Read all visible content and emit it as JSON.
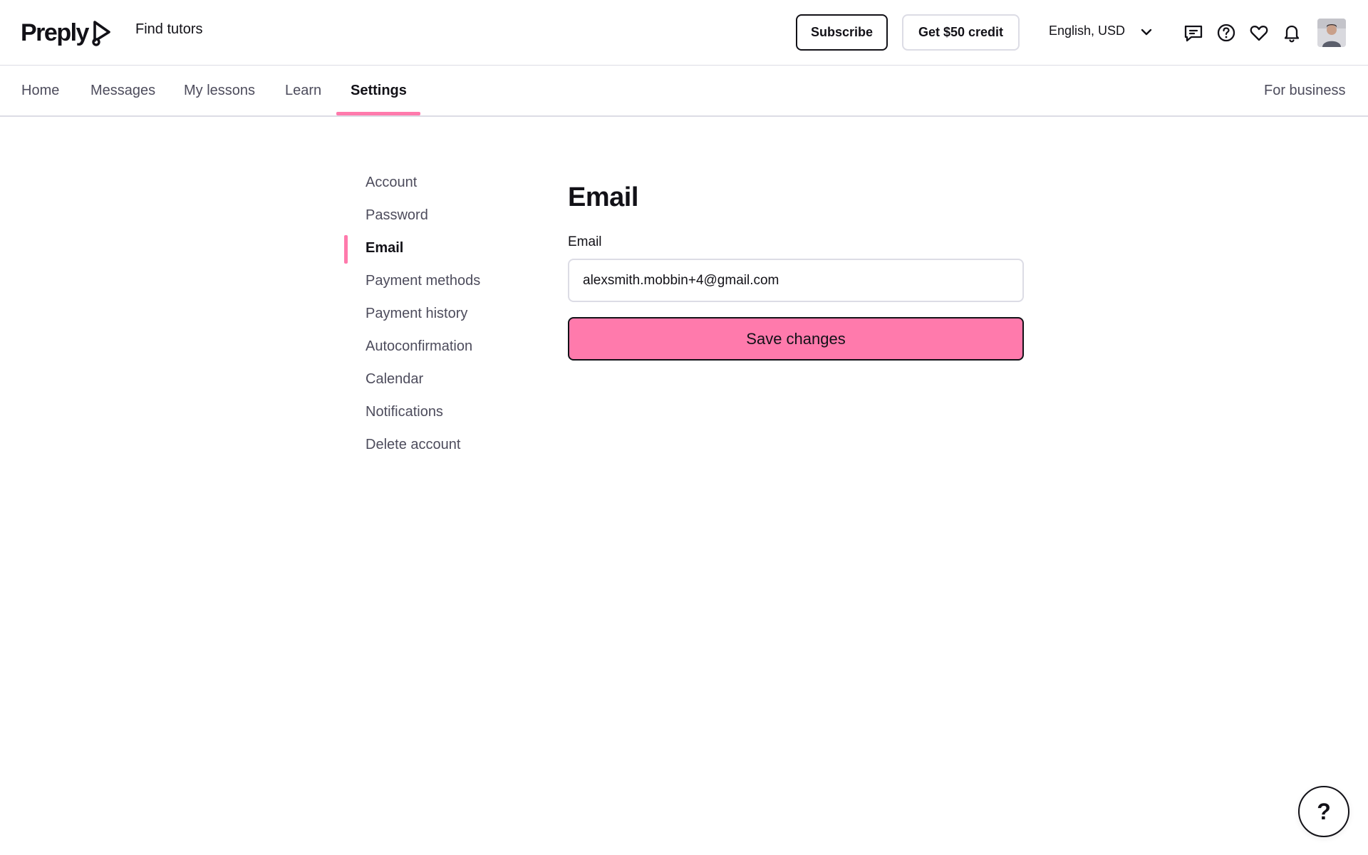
{
  "header": {
    "logo_text": "Preply",
    "find_tutors": "Find tutors",
    "subscribe_label": "Subscribe",
    "credit_label": "Get $50 credit",
    "language_currency": "English, USD",
    "icons": [
      "chat-icon",
      "help-icon",
      "heart-icon",
      "bell-icon"
    ]
  },
  "nav": {
    "items": [
      {
        "label": "Home"
      },
      {
        "label": "Messages"
      },
      {
        "label": "My lessons"
      },
      {
        "label": "Learn"
      },
      {
        "label": "Settings",
        "active": true
      }
    ],
    "business_label": "For business"
  },
  "sidebar": {
    "items": [
      {
        "label": "Account"
      },
      {
        "label": "Password"
      },
      {
        "label": "Email",
        "active": true
      },
      {
        "label": "Payment methods"
      },
      {
        "label": "Payment history"
      },
      {
        "label": "Autoconfirmation"
      },
      {
        "label": "Calendar"
      },
      {
        "label": "Notifications"
      },
      {
        "label": "Delete account"
      }
    ]
  },
  "main": {
    "title": "Email",
    "email_label": "Email",
    "email_value": "alexsmith.mobbin+4@gmail.com",
    "save_label": "Save changes"
  },
  "help_fab": {
    "label": "?"
  },
  "colors": {
    "accent_pink": "#ff7aac",
    "text_primary": "#121117",
    "text_secondary": "#4d4c5c",
    "border": "#dcdce5"
  }
}
